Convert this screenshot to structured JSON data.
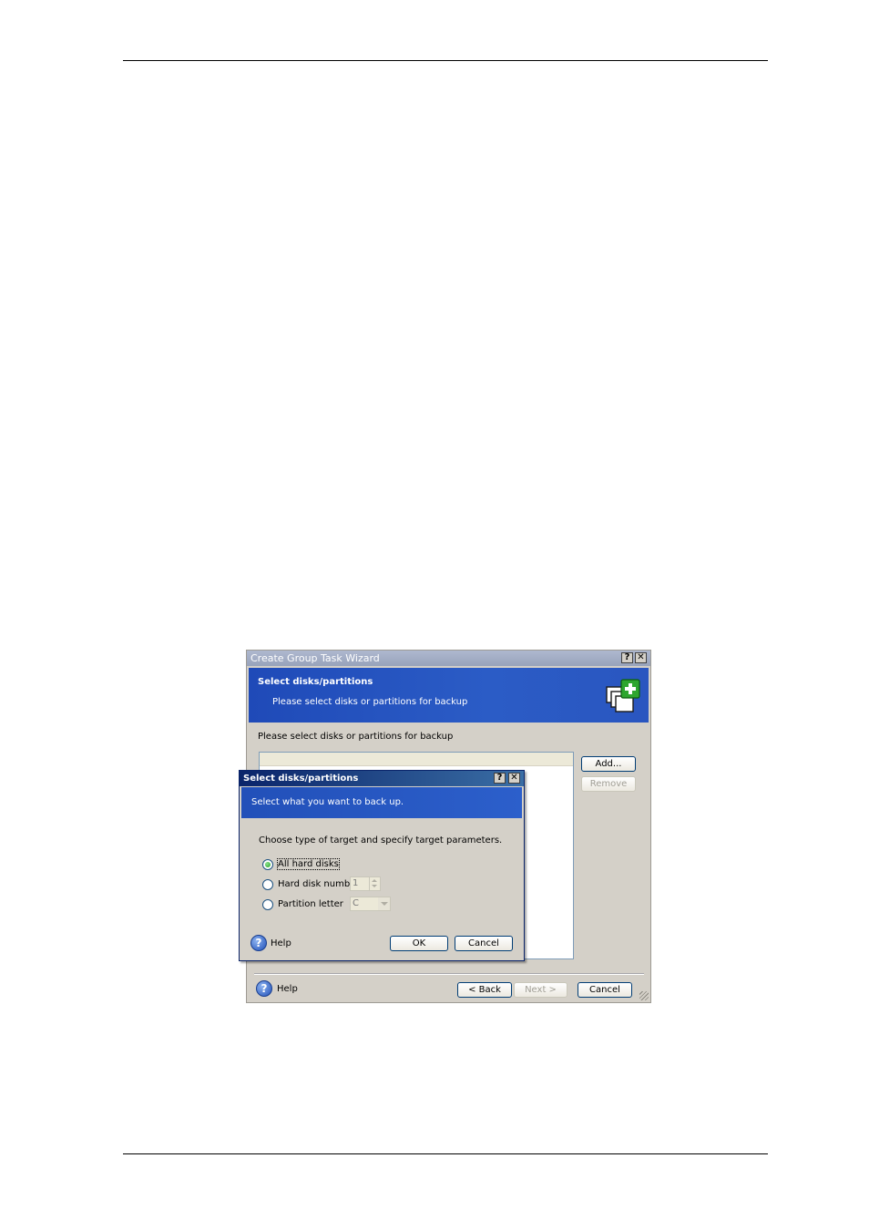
{
  "wizard": {
    "title": "Create Group Task Wizard",
    "title_help": "?",
    "title_close": "✕",
    "header_title": "Select disks/partitions",
    "header_subtitle": "Please select disks or partitions for backup",
    "prompt": "Please select disks or partitions for backup",
    "add_label": "Add...",
    "remove_label": "Remove",
    "help_label": "Help",
    "back_label": "< Back",
    "next_label": "Next >",
    "cancel_label": "Cancel",
    "icons": {
      "header": "add-disks-icon",
      "help": "help-icon",
      "grip": "resize-grip-icon"
    }
  },
  "dialog": {
    "title": "Select disks/partitions",
    "title_help": "?",
    "title_close": "✕",
    "header_subtitle": "Select what you want to back up.",
    "intro": "Choose type of target and specify target parameters.",
    "options": [
      {
        "label": "All hard disks",
        "checked": true
      },
      {
        "label": "Hard disk number",
        "checked": false
      },
      {
        "label": "Partition letter",
        "checked": false
      }
    ],
    "disk_number_value": "1",
    "partition_letter_value": "C",
    "help_label": "Help",
    "ok_label": "OK",
    "cancel_label": "Cancel"
  },
  "colors": {
    "header_blue": "#2b5cc6",
    "dialog_title_blue": "#0a246a",
    "window_face": "#d4d0c8"
  }
}
